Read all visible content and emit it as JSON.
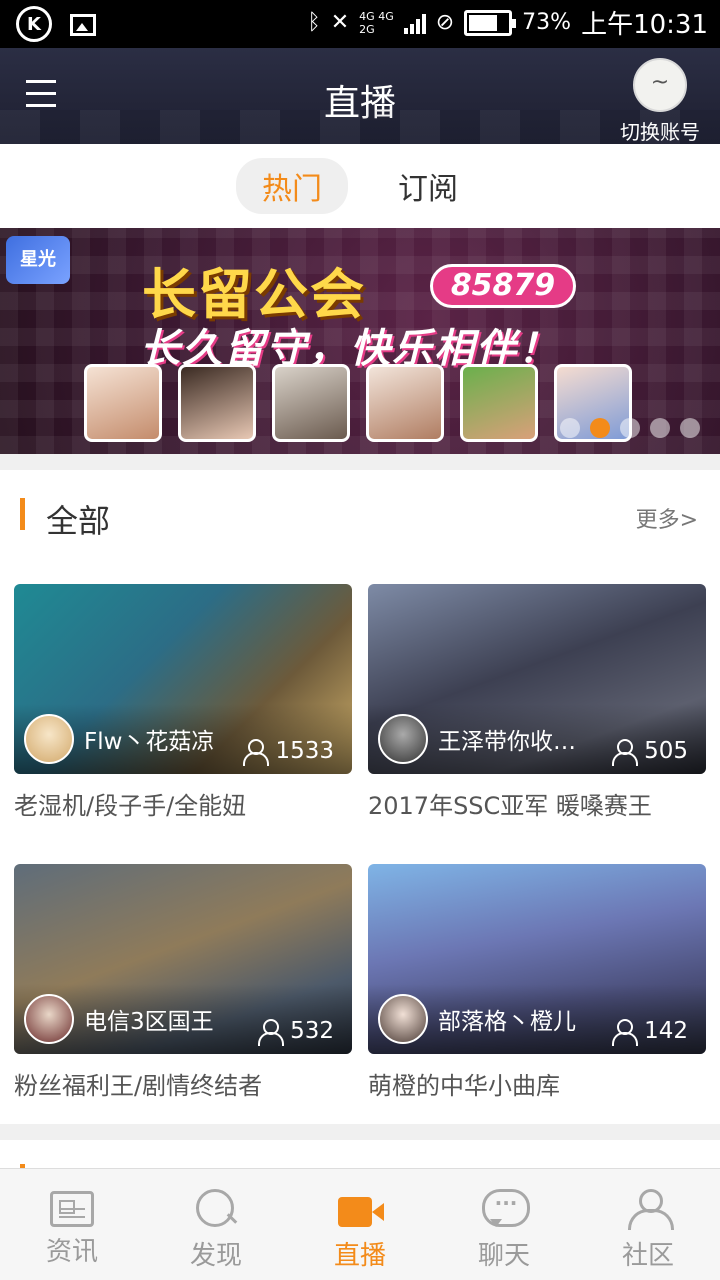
{
  "status_bar": {
    "network_top": "4G 4G",
    "network_bottom": "2G",
    "battery_percent": "73%",
    "battery_level": 0.73,
    "time": "上午10:31"
  },
  "header": {
    "title": "直播",
    "account_label": "切换账号"
  },
  "tabs": [
    {
      "label": "热门",
      "active": true
    },
    {
      "label": "订阅",
      "active": false
    }
  ],
  "banner": {
    "logo_text": "星光",
    "headline": "长留公会",
    "badge": "85879",
    "subline": "长久留守，快乐相伴！",
    "active_dot": 2,
    "dot_count": 5
  },
  "section": {
    "title": "全部",
    "more": "更多>"
  },
  "streams": [
    {
      "streamer": "Flw丶花菇凉",
      "viewers": "1533",
      "description": "老湿机/段子手/全能妞"
    },
    {
      "streamer": "王泽带你收…",
      "viewers": "505",
      "description": "2017年SSC亚军 暖嗓赛王"
    },
    {
      "streamer": "电信3区国王",
      "viewers": "532",
      "description": "粉丝福利王/剧情终结者"
    },
    {
      "streamer": "部落格丶橙儿",
      "viewers": "142",
      "description": "萌橙的中华小曲库"
    }
  ],
  "bottom_nav": [
    {
      "label": "资讯",
      "icon": "news-icon",
      "active": false
    },
    {
      "label": "发现",
      "icon": "search-icon",
      "active": false
    },
    {
      "label": "直播",
      "icon": "live-camera-icon",
      "active": true
    },
    {
      "label": "聊天",
      "icon": "chat-icon",
      "active": false
    },
    {
      "label": "社区",
      "icon": "community-icon",
      "active": false
    }
  ],
  "colors": {
    "accent": "#f38b1a",
    "header_bg": "#232538"
  }
}
